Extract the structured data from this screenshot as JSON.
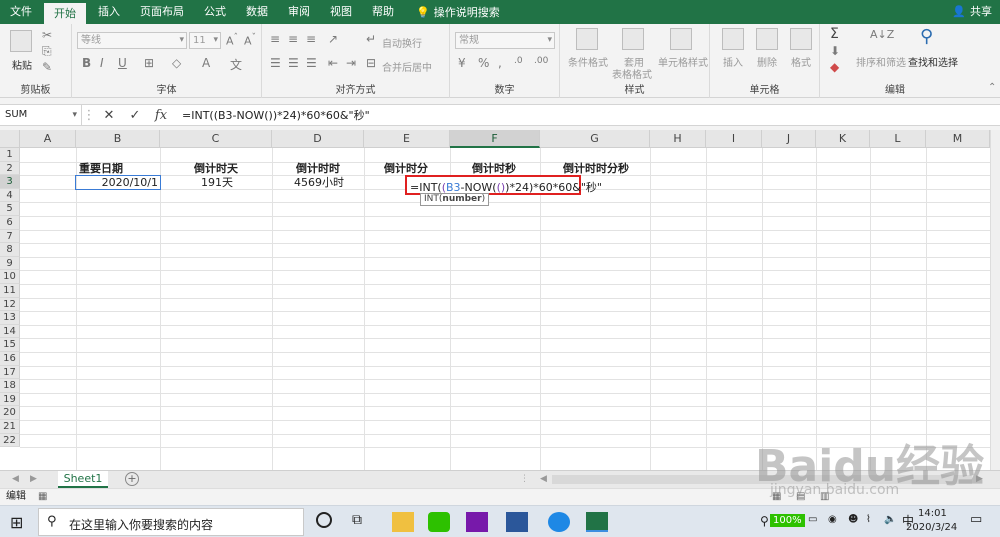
{
  "tabs": [
    "文件",
    "开始",
    "插入",
    "页面布局",
    "公式",
    "数据",
    "审阅",
    "视图",
    "帮助"
  ],
  "active_tab": "开始",
  "tell_me": "操作说明搜索",
  "share": "共享",
  "ribbon": {
    "clipboard": {
      "paste": "粘贴",
      "label": "剪贴板"
    },
    "font": {
      "name": "等线",
      "size": "11",
      "label": "字体"
    },
    "alignment": {
      "wrap": "自动换行",
      "merge": "合并后居中",
      "label": "对齐方式"
    },
    "number": {
      "format": "常规",
      "label": "数字"
    },
    "styles": {
      "conditional": "条件格式",
      "table": "套用",
      "table2": "表格格式",
      "cell": "单元格样式",
      "label": "样式"
    },
    "cells": {
      "insert": "插入",
      "delete": "删除",
      "format": "格式",
      "label": "单元格"
    },
    "editing": {
      "sort": "排序和筛选",
      "find": "查找和选择",
      "label": "编辑"
    }
  },
  "formula_bar": {
    "name_box": "SUM",
    "formula": "=INT((B3-NOW())*24)*60*60&\"秒\""
  },
  "columns": [
    "A",
    "B",
    "C",
    "D",
    "E",
    "F",
    "G",
    "H",
    "I",
    "J",
    "K",
    "L",
    "M"
  ],
  "rows": [
    "1",
    "2",
    "3",
    "4",
    "5",
    "6",
    "7",
    "8",
    "9",
    "10",
    "11",
    "12",
    "13",
    "14",
    "15",
    "16",
    "17",
    "18",
    "19",
    "20",
    "21",
    "22"
  ],
  "cells": {
    "b2": "重要日期",
    "c2": "倒计时天",
    "d2": "倒计时时",
    "e2": "倒计时分",
    "f2": "倒计时秒",
    "g2": "倒计时时分秒",
    "b3": "2020/10/1",
    "c3": "191天",
    "d3": "4569小时"
  },
  "edit": {
    "p1": "=INT(",
    "p2": "(",
    "p3": "B3",
    "p4": "-NOW(",
    "p5": "()",
    "p6": ")*24)*60*60&\"秒\"",
    "tooltip_fn": "INT(",
    "tooltip_arg": "number",
    "tooltip_close": ")"
  },
  "sheet_tab": "Sheet1",
  "status_mode": "编辑",
  "taskbar": {
    "search_placeholder": "在这里输入你要搜索的内容",
    "battery": "100%",
    "ime": "中",
    "time": "14:01",
    "date": "2020/3/24"
  },
  "watermark": "Baidu经验",
  "watermark_url": "jingyan.baidu.com",
  "colors": {
    "excel_green": "#217346",
    "highlight_red": "#e02020",
    "ref_blue": "#3a7bd5",
    "paren_purple": "#7a3fb0"
  }
}
